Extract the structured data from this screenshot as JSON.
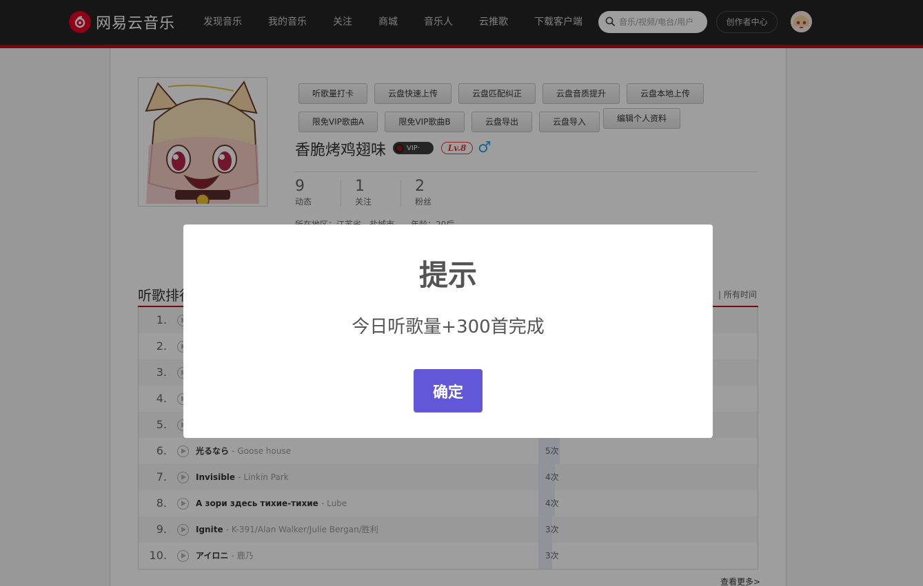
{
  "header": {
    "logo_text": "网易云音乐",
    "nav": [
      "发现音乐",
      "我的音乐",
      "关注",
      "商城",
      "音乐人",
      "云推歌",
      "下载客户端"
    ],
    "search_placeholder": "音乐/视频/电台/用户",
    "creator_label": "创作者中心",
    "accent": "#c20c0c"
  },
  "profile": {
    "tool_buttons_row1": [
      "听歌量打卡",
      "云盘快速上传",
      "云盘匹配纠正",
      "云盘音质提升",
      "云盘本地上传"
    ],
    "tool_buttons_row2": [
      "限免VIP歌曲A",
      "限免VIP歌曲B",
      "云盘导出",
      "云盘导入",
      "编辑个人资料"
    ],
    "nickname": "香脆烤鸡翅味",
    "vip_label": "VIP·",
    "level": "Lv.8",
    "gender_symbol": "♂",
    "stats": [
      {
        "num": "9",
        "label": "动态"
      },
      {
        "num": "1",
        "label": "关注"
      },
      {
        "num": "2",
        "label": "粉丝"
      }
    ],
    "location": "所在地区：江苏省 - 盐城市　　年龄：20后"
  },
  "ranking": {
    "title": "听歌排行",
    "time_tab": "|  所有时间",
    "rows": [
      {
        "idx": "1.",
        "song": "",
        "artist": "",
        "count": "",
        "bar_frac": 1.0
      },
      {
        "idx": "2.",
        "song": "",
        "artist": "",
        "count": "",
        "bar_frac": 0.0
      },
      {
        "idx": "3.",
        "song": "",
        "artist": "",
        "count": "",
        "bar_frac": 0.0
      },
      {
        "idx": "4.",
        "song": "",
        "artist": "",
        "count": "",
        "bar_frac": 0.0
      },
      {
        "idx": "5.",
        "song": "",
        "artist": "",
        "count": "",
        "bar_frac": 0.0
      },
      {
        "idx": "6.",
        "song": "光るなら",
        "artist": "- Goose house",
        "count": "5次",
        "bar_frac": 0.14
      },
      {
        "idx": "7.",
        "song": "Invisible",
        "artist": "- Linkin Park",
        "count": "4次",
        "bar_frac": 0.11
      },
      {
        "idx": "8.",
        "song": "А зори здесь тихие-тихие",
        "artist": "- Lube",
        "count": "4次",
        "bar_frac": 0.11
      },
      {
        "idx": "9.",
        "song": "Ignite",
        "artist": "- K-391/Alan Walker/Julie Bergan/胜利",
        "count": "3次",
        "bar_frac": 0.09
      },
      {
        "idx": "10.",
        "song": "アイロニ",
        "artist": "- 鹿乃",
        "count": "3次",
        "bar_frac": 0.09
      }
    ],
    "more_label": "查看更多>"
  },
  "dialog": {
    "title": "提示",
    "message": "今日听歌量+300首完成",
    "ok_label": "确定"
  }
}
